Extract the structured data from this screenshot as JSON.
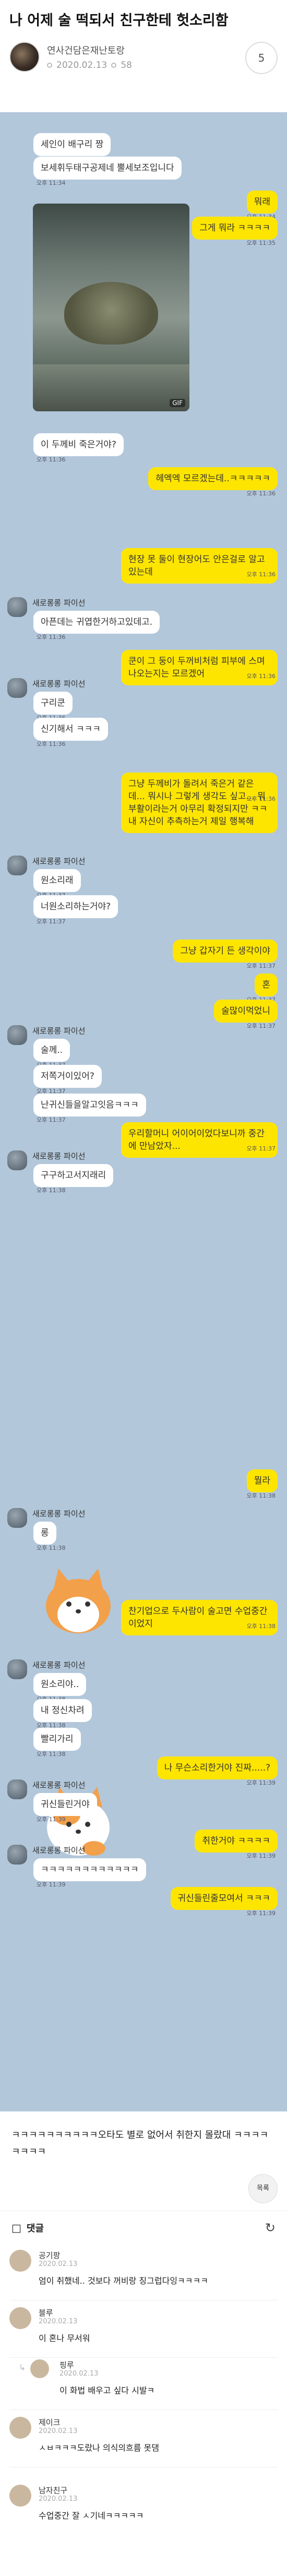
{
  "post": {
    "title": "나 어제 술 떡되서 친구한테 헛소리함",
    "author": "연사건담은재난토랑",
    "date": "2020.02.13",
    "views": "58",
    "comment_count": "5",
    "body": "ㅋㅋㅋㅋㅋㅋㅋㅋㅋㅋ오타도 별로 없어서 취한지 몰랐대 ㅋㅋㅋㅋㅋㅋㅋㅋ",
    "float_label": "목록"
  },
  "chat": {
    "friend_name": "새로롱롱 파이선",
    "messages": [
      {
        "side": "right",
        "text": "세인이 배구리 짱",
        "time": "오후 11:34"
      },
      {
        "side": "right",
        "text": "보세휘두태구공제네 뿔세보조입니다",
        "time": "오후 11:34"
      },
      {
        "side": "left",
        "text": "뭐래",
        "time": "오후 11:34"
      },
      {
        "side": "left",
        "text": "그게 뭐라 ㅋㅋㅋㅋ",
        "time": "오후 11:35"
      },
      {
        "side": "right",
        "text": "이 두께비 죽은거야?",
        "time": "오후 11:36"
      },
      {
        "side": "left",
        "text": "헤엑엑 모르겠는데..ㅋㅋㅋㅋㅋ",
        "time": "오후 11:36"
      },
      {
        "side": "left",
        "text": "현장 못 둘이 현장어도 안은걸로 알고있는데",
        "time": "오후 11:36"
      },
      {
        "side": "right",
        "text": "아픈데는 귀엽한거하고있데고.",
        "time": "오후 11:36"
      },
      {
        "side": "left",
        "text": "쿤이 그 둥이 두꺼비처럼 피부에 스며나오는지는 모르겠어",
        "time": "오후 11:36"
      },
      {
        "side": "right",
        "text": "구리쿤",
        "time": "오후 11:36"
      },
      {
        "side": "right",
        "text": "신기해서 ㅋㅋㅋ",
        "time": "오후 11:36"
      },
      {
        "side": "left",
        "text": "그냥 두께비가 돌려서 죽은거 같은데... 뭐시나 그렇게 생각도 싶고... 뭐 부활이라는거 아무리 확정되지만 ㅋㅋ 내 자신이 추측하는거 제일 행복해",
        "time": "오후 11:36"
      },
      {
        "side": "right",
        "text": "원소리래",
        "time": "오후 11:37"
      },
      {
        "side": "right",
        "text": "너원소리하는거야?",
        "time": "오후 11:37"
      },
      {
        "side": "left",
        "text": "그냥 갑자기 든 생각이야",
        "time": "오후 11:37"
      },
      {
        "side": "left",
        "text": "혼",
        "time": "오후 11:37"
      },
      {
        "side": "left",
        "text": "술많이먹었니",
        "time": "오후 11:37"
      },
      {
        "side": "right",
        "text": "술께..",
        "time": "오후 11:37"
      },
      {
        "side": "right",
        "text": "저쪽거이있어?",
        "time": "오후 11:37"
      },
      {
        "side": "right",
        "text": "난귀신들을알고잇음ㅋㅋㅋ",
        "time": "오후 11:37"
      },
      {
        "side": "left",
        "text": "우리할머니 어이어이었다보니까 중간에 만남았자...",
        "time": "오후 11:37"
      },
      {
        "side": "right",
        "text": "구구하고서지래리",
        "time": "오후 11:38"
      },
      {
        "side": "left",
        "text": "뭘라",
        "time": "오후 11:38"
      },
      {
        "side": "right",
        "text": "롱",
        "time": "오후 11:38"
      },
      {
        "side": "left",
        "text": "찬기업으로 두사람이 술고면 수업중간이었지",
        "time": "오후 11:38"
      },
      {
        "side": "right",
        "text": "원소리야..",
        "time": "오후 11:38"
      },
      {
        "side": "right",
        "text": "내 정신차려",
        "time": "오후 11:38"
      },
      {
        "side": "right",
        "text": "빨리가리",
        "time": "오후 11:38"
      },
      {
        "side": "left",
        "text": "나 무슨소리한거야 진짜.....?",
        "time": "오후 11:39"
      },
      {
        "side": "right",
        "text": "귀신들린거야",
        "time": "오후 11:39"
      },
      {
        "side": "left",
        "text": "취한거야 ㅋㅋㅋㅋ",
        "time": "오후 11:39"
      },
      {
        "side": "right",
        "text": "ㅋㅋㅋㅋㅋㅋㅋㅋㅋㅋㅋㅋ",
        "time": "오후 11:39"
      },
      {
        "side": "left",
        "text": "귀신들린줄모여서 ㅋㅋㅋ",
        "time": "오후 11:39"
      }
    ],
    "photo_badge": "GIF"
  },
  "comments": {
    "label": "댓글",
    "items": [
      {
        "name": "공기팡",
        "date": "2020.02.13",
        "text": "엄이 취했네.. 것보다 꺼비랑 징그럽다잉ㅋㅋㅋㅋ",
        "reply": false
      },
      {
        "name": "블루",
        "date": "2020.02.13",
        "text": "이 혼나 무서워",
        "reply": false
      },
      {
        "name": "핑루",
        "date": "2020.02.13",
        "text": "이 화법 배우고 싶다 시발ㅋ",
        "reply": true
      },
      {
        "name": "제이크",
        "date": "2020.02.13",
        "text": "ㅅㅂㅋㅋㅋ도랐나 의식의흐름 못댐",
        "reply": false
      },
      {
        "name": "남자친구",
        "date": "2020.02.13",
        "text": "수업중간 잘 ㅅ기네ㅋㅋㅋㅋㅋ",
        "reply": false
      }
    ]
  },
  "colors": {
    "chat_bg": "#b2c7da",
    "my_bubble": "#fee500",
    "their_bubble": "#ffffff"
  }
}
